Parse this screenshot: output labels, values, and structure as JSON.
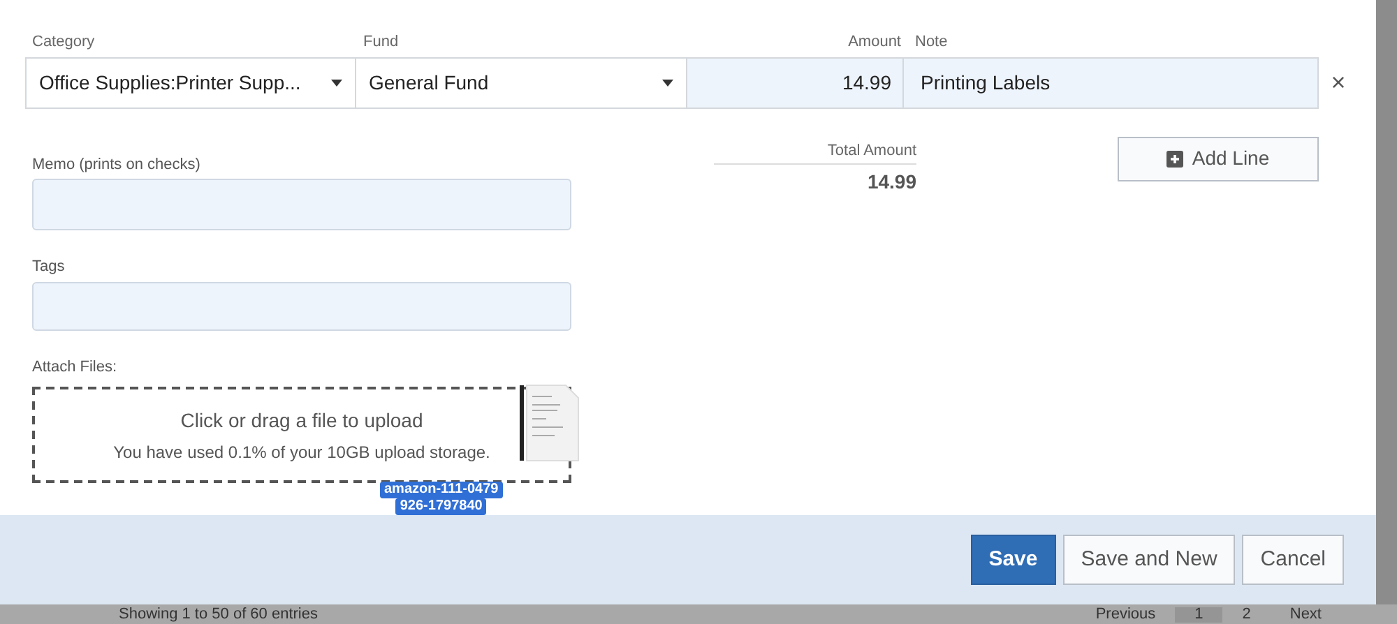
{
  "line_item": {
    "category": {
      "label": "Category",
      "value": "Office Supplies:Printer Supp..."
    },
    "fund": {
      "label": "Fund",
      "value": "General Fund"
    },
    "amount": {
      "label": "Amount",
      "value": "14.99"
    },
    "note": {
      "label": "Note",
      "value": "Printing Labels"
    },
    "remove": "×"
  },
  "memo": {
    "label": "Memo (prints on checks)"
  },
  "tags": {
    "label": "Tags"
  },
  "total": {
    "label": "Total Amount",
    "value": "14.99"
  },
  "add_line": "Add Line",
  "attach": {
    "label": "Attach Files:",
    "title": "Click or drag a file to upload",
    "usage": "You have used 0.1% of your 10GB upload storage.",
    "dragged_file": [
      "amazon-111-0479",
      "926-1797840"
    ]
  },
  "buttons": [
    {
      "label": "Save",
      "kind": "primary"
    },
    {
      "label": "Save and New",
      "kind": "secondary"
    },
    {
      "label": "Cancel",
      "kind": "secondary"
    }
  ],
  "background_page": {
    "entries": "Showing 1 to 50 of 60 entries",
    "pagination": [
      {
        "label": "Previous",
        "selected": false
      },
      {
        "label": "1",
        "selected": true
      },
      {
        "label": "2",
        "selected": false
      },
      {
        "label": "Next",
        "selected": false
      }
    ]
  }
}
